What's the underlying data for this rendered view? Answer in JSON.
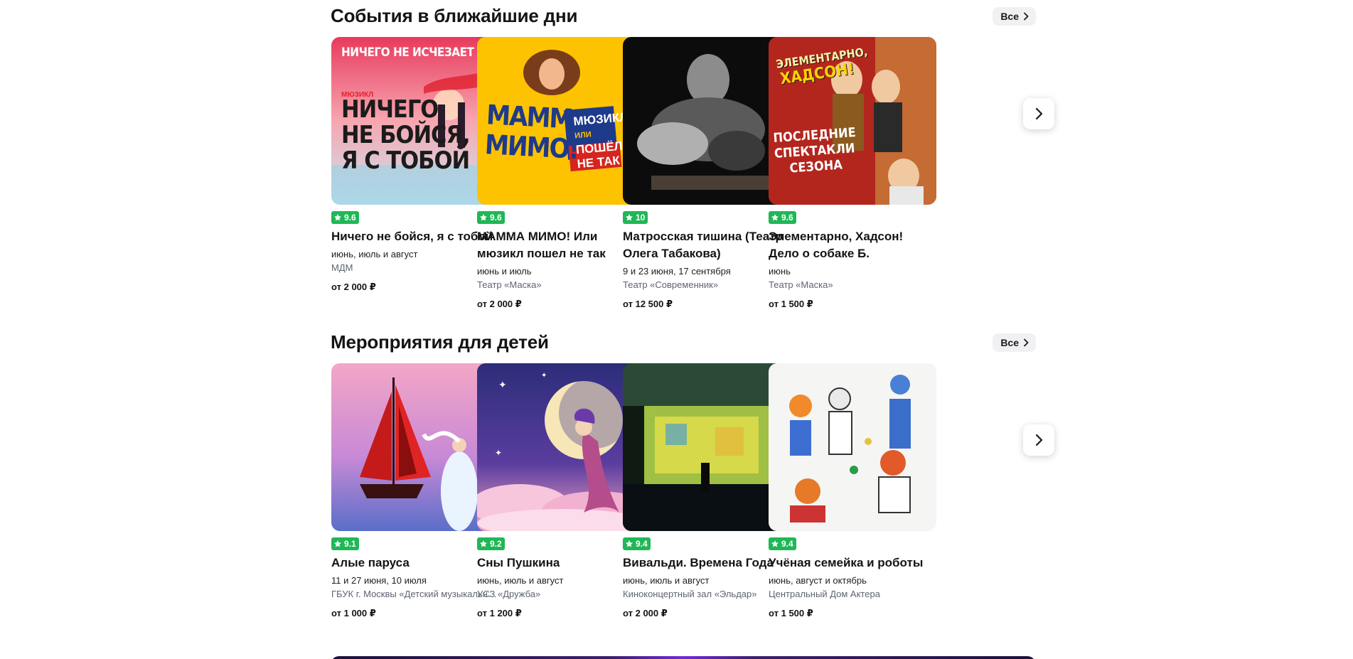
{
  "sections": [
    {
      "title": "События в ближайшие дни",
      "all_label": "Все",
      "cards": [
        {
          "rating": "9.6",
          "title": "Ничего не бойся, я с тобой",
          "dates": "июнь, июль и август",
          "venue": "МДМ",
          "price": "от 2 000 ₽",
          "poster_text": [
            "НИЧЕГО НЕ ИСЧЕЗАЕТ",
            "МЮЗИКЛ",
            "НИЧЕГО",
            "НЕ БОЙСЯ,",
            "Я С ТОБОЙ"
          ]
        },
        {
          "rating": "9.6",
          "title": "МАММА МИМО! Или мюзикл пошел не так",
          "dates": "июнь и июль",
          "venue": "Театр «Маска»",
          "price": "от 2 000 ₽",
          "poster_text": [
            "МАММА",
            "МИМО!",
            "МЮЗИКЛ",
            "ИЛИ",
            "ПОШЁЛ",
            "НЕ ТАК"
          ]
        },
        {
          "rating": "10",
          "title": "Матросская тишина (Театр Олега Табакова)",
          "dates": "9 и 23 июня, 17 сентября",
          "venue": "Театр «Современник»",
          "price": "от 12 500 ₽",
          "poster_text": []
        },
        {
          "rating": "9.6",
          "title": "Элементарно, Хадсон! Дело о собаке Б.",
          "dates": "июнь",
          "venue": "Театр «Маска»",
          "price": "от 1 500 ₽",
          "poster_text": [
            "ЭЛЕМЕНТАРНО,",
            "ХАДСОН!",
            "ПОСЛЕДНИЕ",
            "СПЕКТАКЛИ",
            "СЕЗОНА"
          ]
        }
      ]
    },
    {
      "title": "Мероприятия для детей",
      "all_label": "Все",
      "cards": [
        {
          "rating": "9.1",
          "title": "Алые паруса",
          "dates": "11 и 27 июня, 10 июля",
          "venue": "ГБУК г. Москвы «Детский музыкальный театр»",
          "price": "от 1 000 ₽"
        },
        {
          "rating": "9.2",
          "title": "Сны Пушкина",
          "dates": "июнь, июль и август",
          "venue": "УСЗ «Дружба»",
          "price": "от 1 200 ₽"
        },
        {
          "rating": "9.4",
          "title": "Вивальди. Времена Года",
          "dates": "июнь, июль и август",
          "venue": "Киноконцертный зал «Эльдар»",
          "price": "от 2 000 ₽"
        },
        {
          "rating": "9.4",
          "title": "Учёная семейка и роботы",
          "dates": "июнь, август и октябрь",
          "venue": "Центральный Дом Актера",
          "price": "от 1 500 ₽"
        }
      ]
    }
  ],
  "colors": {
    "rating_badge": "#20b756",
    "all_button_bg": "#f1f1f3",
    "venue_text": "#5e6470"
  },
  "icons": {
    "all_button": "chevron-right-icon",
    "next_arrow": "chevron-right-icon",
    "rating": "star-icon"
  }
}
